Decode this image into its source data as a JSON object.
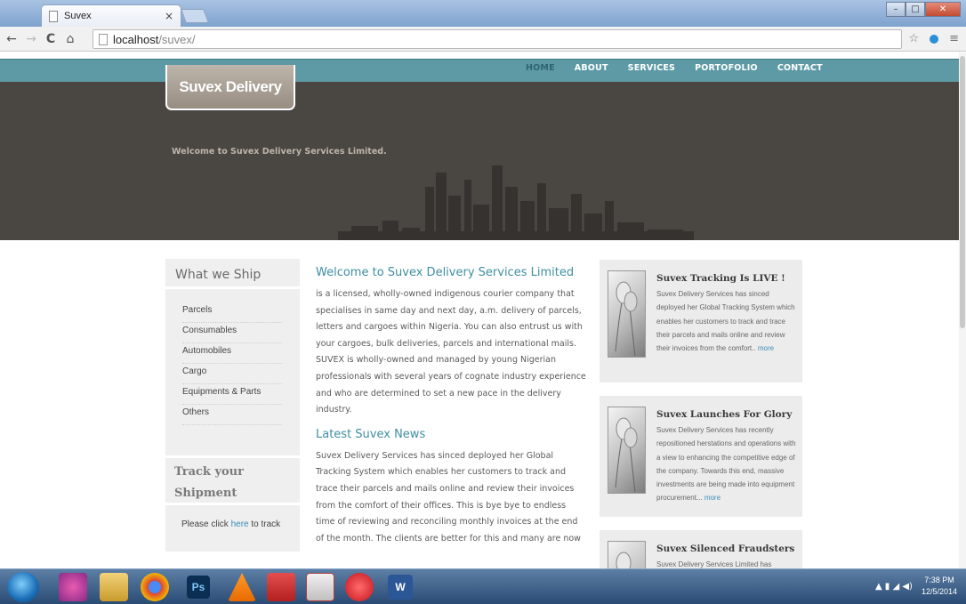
{
  "browser": {
    "tab_title": "Suvex",
    "tab_close": "×",
    "url_host": "localhost",
    "url_path": "/suvex/",
    "back": "←",
    "forward": "→",
    "reload": "C",
    "home": "ñ",
    "star": "☆",
    "menu": "≡"
  },
  "site": {
    "logo": "Suvex Delivery",
    "nav": [
      "HOME",
      "ABOUT",
      "SERVICES",
      "PORTOFOLIO",
      "CONTACT"
    ],
    "banner": "Welcome to Suvex Delivery Services Limited."
  },
  "sidebar": {
    "heading": "What we Ship",
    "items": [
      "Parcels",
      "Consumables",
      "Automobiles",
      "Cargo",
      "Equipments & Parts",
      "Others"
    ],
    "track_heading_1": "Track your",
    "track_heading_2": "Shipment",
    "track_prefix": "Please click ",
    "track_link": "here",
    "track_suffix": " to track"
  },
  "main": {
    "welcome_title": "Welcome to Suvex Delivery Services Limited",
    "welcome_text": "is a licensed, wholly-owned indigenous courier company that specialises in same day and next day, a.m. delivery of parcels, letters and cargoes within Nigeria. You can also entrust us with your cargoes, bulk deliveries, parcels and international mails. SUVEX is wholly-owned and managed by young Nigerian professionals with several years of cognate industry experience and who are determined to set a new pace in the delivery industry.",
    "news_title": "Latest Suvex News",
    "news_text": "Suvex Delivery Services has sinced deployed her Global Tracking System which enables her customers to track and trace their parcels and mails online and review their invoices from the comfort of their offices. This is bye bye to endless time of reviewing and reconciling monthly invoices at the end of the month. The clients are better for this and many are now"
  },
  "news": [
    {
      "title": "Suvex Tracking Is LIVE !",
      "text": "Suvex Delivery Services has sinced deployed her Global Tracking System which enables her customers to track and trace their parcels and mails online and review their invoices from the comfort.. ",
      "more": "more"
    },
    {
      "title": "Suvex Launches For Glory",
      "text": "Suvex Delivery Services has recently repositioned herstations and operations with a view to enhancing the competitive edge of the company. Towards this end, massive investments are being made into equipment procurement... ",
      "more": "more"
    },
    {
      "title": "Suvex Silenced Fraudsters",
      "text": "Suvex Delivery Services Limited has",
      "more": ""
    }
  ],
  "taskbar": {
    "apps": [
      "Ps",
      "W"
    ],
    "time": "7:38 PM",
    "date": "12/5/2014"
  },
  "colors": {
    "nav_strip": "#5d9aa5",
    "hero_bg": "#4a4642",
    "heading_blue": "#3e8ea3",
    "link_blue": "#3a8fb5"
  }
}
